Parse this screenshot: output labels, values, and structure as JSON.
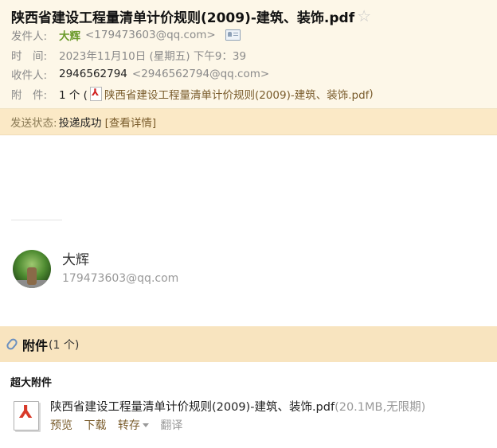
{
  "header": {
    "subject": "陕西省建设工程量清单计价规则(2009)-建筑、装饰.pdf",
    "star_icon": "star-icon",
    "sender": {
      "label": "发件人:",
      "name": "大辉",
      "email": "<179473603@qq.com>",
      "icon": "contact-card-icon"
    },
    "time": {
      "label": "时　间:",
      "value": "2023年11月10日 (星期五) 下午9：39"
    },
    "recipient": {
      "label": "收件人:",
      "name": "2946562794",
      "email": "<2946562794@qq.com>"
    },
    "attachment": {
      "label": "附　件:",
      "count_text": "1 个 (",
      "file_name": "陕西省建设工程量清单计价规则(2009)-建筑、装饰.pdf",
      "close": ")"
    }
  },
  "status": {
    "label": "发送状态:",
    "value": "投递成功",
    "link": "[查看详情]"
  },
  "signature": {
    "name": "大辉",
    "email": "179473603@qq.com"
  },
  "attachments_section": {
    "title": "附件",
    "count": "(1 个)",
    "group_label": "超大附件",
    "items": [
      {
        "name": "陕西省建设工程量清单计价规则(2009)-建筑、装饰.pdf",
        "meta": "(20.1MB,无限期)",
        "actions": {
          "preview": "预览",
          "download": "下载",
          "save": "转存",
          "translate": "翻译"
        }
      }
    ]
  },
  "colors": {
    "header_bg": "#fdf7e8",
    "status_bg": "#fbe9c6",
    "sender_green": "#6a9a2a",
    "link_brown": "#7a5c2c"
  }
}
